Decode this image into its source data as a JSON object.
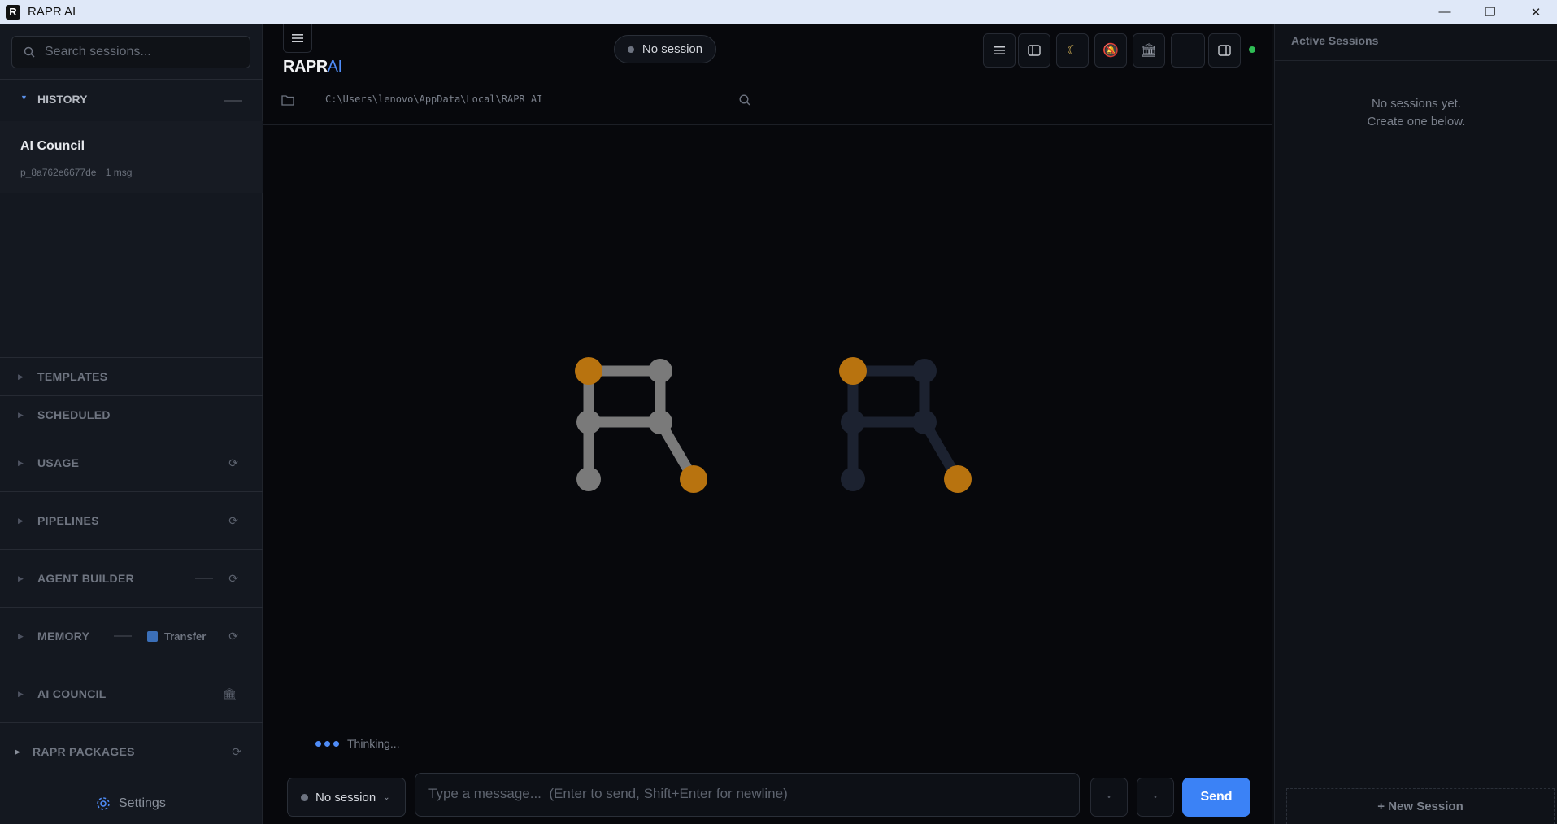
{
  "window": {
    "title": "RAPR AI",
    "app_icon_letter": "R",
    "minimize": "—",
    "restore": "❐",
    "close": "✕"
  },
  "sidebar": {
    "search_placeholder": "Search sessions...",
    "history": {
      "label": "HISTORY",
      "items": [
        {
          "name": "AI Council",
          "id": "p_8a762e6677de",
          "count": "1 msg"
        }
      ]
    },
    "sections": [
      {
        "label": "TEMPLATES"
      },
      {
        "label": "SCHEDULED"
      },
      {
        "label": "USAGE"
      },
      {
        "label": "PIPELINES"
      },
      {
        "label": "AGENT BUILDER"
      },
      {
        "label": "MEMORY",
        "extra": "Transfer"
      },
      {
        "label": "AI COUNCIL"
      },
      {
        "label": "RAPR PACKAGES"
      }
    ],
    "settings_label": "Settings"
  },
  "header": {
    "logo_main": "RAPR",
    "logo_accent": "AI",
    "session_status": "No session",
    "status_color": "#2fbd55"
  },
  "path_bar": {
    "path": "C:\\Users\\lenovo\\AppData\\Local\\RAPR AI"
  },
  "thinking_label": "Thinking...",
  "composer": {
    "session_select": "No session",
    "placeholder": "Type a message...  (Enter to send, Shift+Enter for newline)",
    "send_label": "Send"
  },
  "right_panel": {
    "title": "Active Sessions",
    "empty_line1": "No sessions yet.",
    "empty_line2": "Create one below.",
    "new_session_label": "+ New Session"
  },
  "colors": {
    "accent": "#3b82f6",
    "node_orange": "#b8730f",
    "node_gray": "#7a7a7a"
  }
}
